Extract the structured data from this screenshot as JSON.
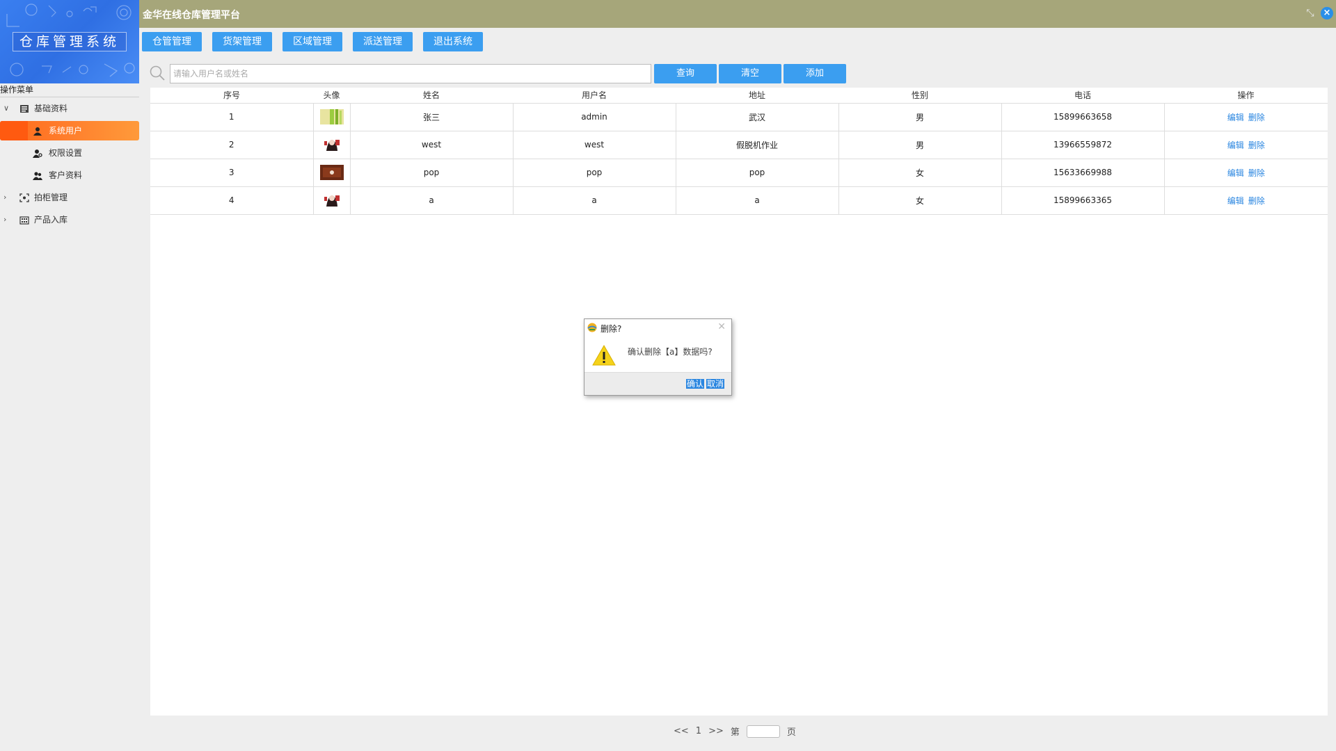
{
  "app": {
    "title": "金华在线仓库管理平台",
    "logo_text": "仓库管理系统"
  },
  "nav": {
    "buttons": [
      "仓管管理",
      "货架管理",
      "区域管理",
      "派送管理",
      "退出系统"
    ]
  },
  "sidebar": {
    "title": "操作菜单",
    "items": [
      {
        "label": "基础资料",
        "level": 1,
        "expanded": true,
        "icon": "book-icon"
      },
      {
        "label": "系统用户",
        "level": 2,
        "active": true,
        "icon": "user-icon"
      },
      {
        "label": "权限设置",
        "level": 2,
        "icon": "user-key-icon"
      },
      {
        "label": "客户资料",
        "level": 2,
        "icon": "users-icon"
      },
      {
        "label": "拍柜管理",
        "level": 1,
        "expanded": false,
        "icon": "scan-icon"
      },
      {
        "label": "产品入库",
        "level": 1,
        "expanded": false,
        "icon": "building-icon"
      }
    ]
  },
  "search": {
    "placeholder": "请输入用户名或姓名",
    "query_label": "查询",
    "clear_label": "清空",
    "add_label": "添加"
  },
  "table": {
    "headers": [
      "序号",
      "头像",
      "姓名",
      "用户名",
      "地址",
      "性别",
      "电话",
      "操作"
    ],
    "rows": [
      {
        "no": "1",
        "avatar": "green-leaf-image",
        "name": "张三",
        "username": "admin",
        "address": "武汉",
        "gender": "男",
        "phone": "15899663658"
      },
      {
        "no": "2",
        "avatar": "anime-girl-image",
        "name": "west",
        "username": "west",
        "address": "假脱机作业",
        "gender": "男",
        "phone": "13966559872"
      },
      {
        "no": "3",
        "avatar": "brown-photo-image",
        "name": "pop",
        "username": "pop",
        "address": "pop",
        "gender": "女",
        "phone": "15633669988"
      },
      {
        "no": "4",
        "avatar": "anime-girl-image",
        "name": "a",
        "username": "a",
        "address": "a",
        "gender": "女",
        "phone": "15899663365"
      }
    ],
    "edit_label": "编辑",
    "delete_label": "删除"
  },
  "pager": {
    "prev": "<<",
    "page": "1",
    "next": ">>",
    "goto_prefix": "第",
    "goto_suffix": "页"
  },
  "dialog": {
    "title": "删除?",
    "message": "确认删除【a】数据吗?",
    "confirm_label": "确认",
    "cancel_label": "取消"
  },
  "colors": {
    "topbar": "#a6a67a",
    "primary_button": "#3b9ef0",
    "active_menu": "#ff7a2a"
  }
}
